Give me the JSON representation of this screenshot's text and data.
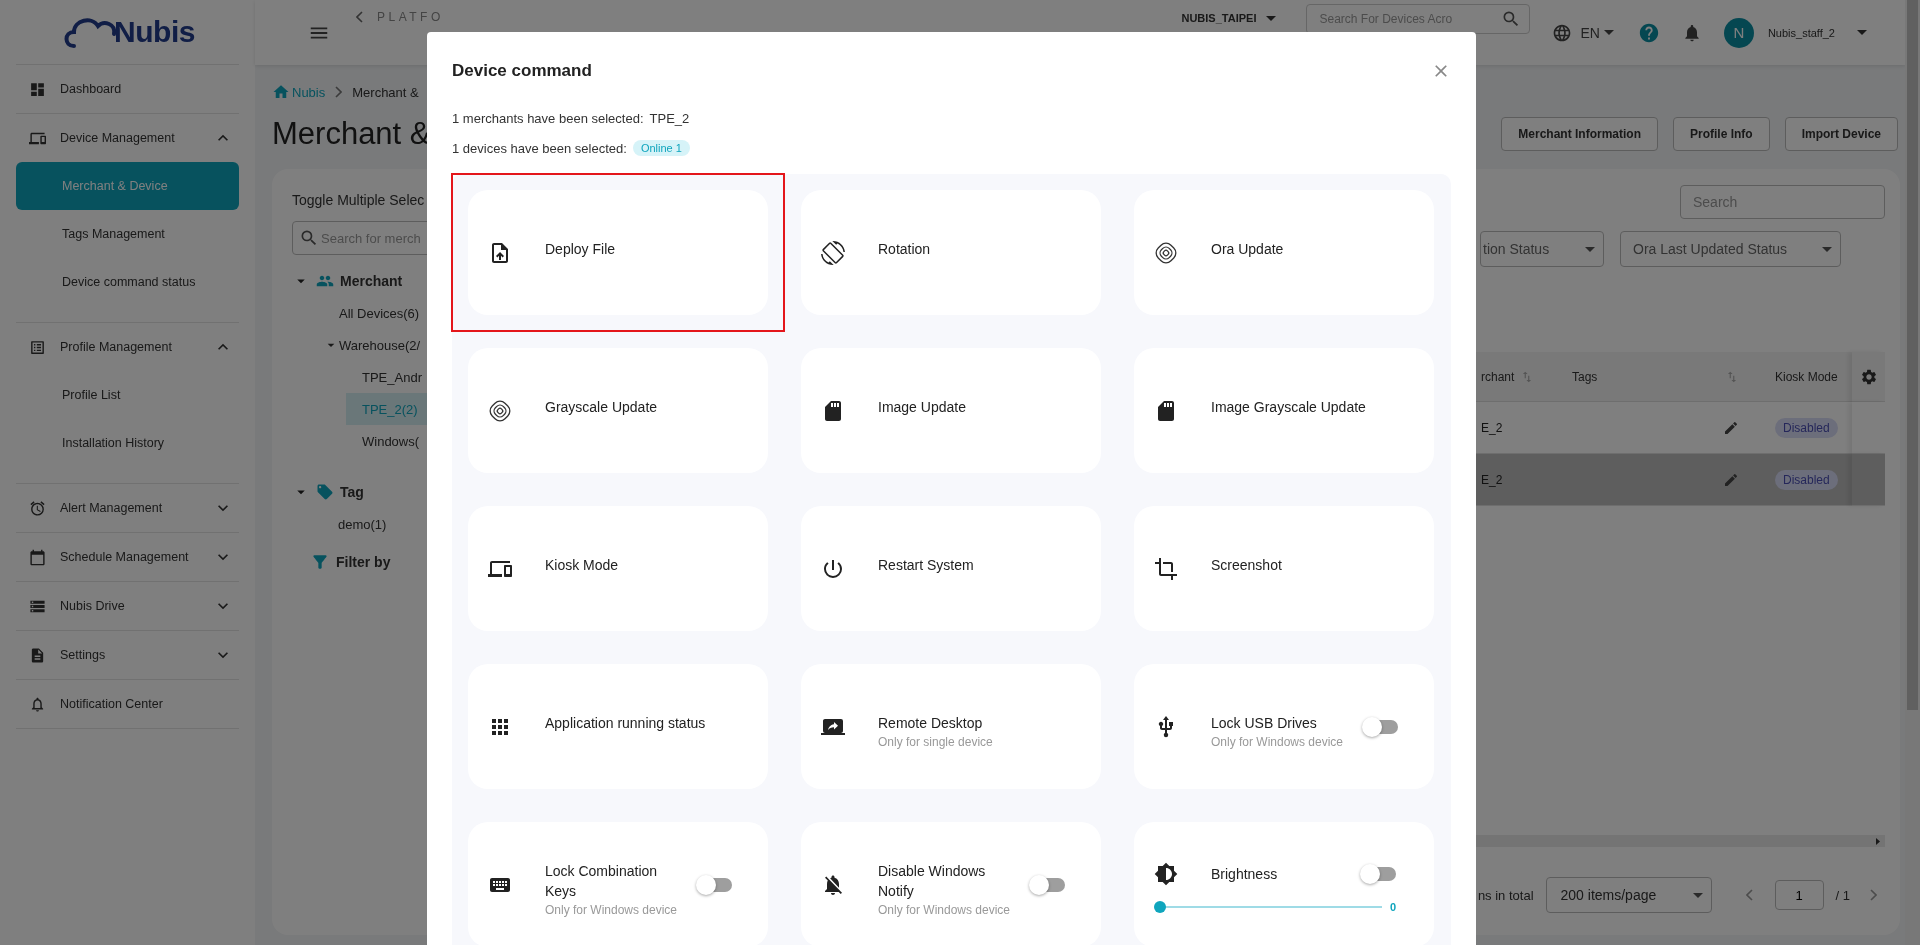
{
  "sidebar": {
    "logo": "Nubis",
    "items": [
      {
        "kind": "link",
        "label": "Dashboard",
        "selected": false
      },
      {
        "kind": "group",
        "label": "Device Management",
        "expanded": true,
        "children": [
          {
            "label": "Merchant & Device",
            "selected": true
          },
          {
            "label": "Tags Management",
            "selected": false
          },
          {
            "label": "Device command status",
            "selected": false
          }
        ]
      },
      {
        "kind": "group",
        "label": "Profile Management",
        "expanded": true,
        "children": [
          {
            "label": "Profile List",
            "selected": false
          },
          {
            "label": "Installation History",
            "selected": false
          }
        ]
      },
      {
        "kind": "group",
        "label": "Alert Management",
        "expanded": false
      },
      {
        "kind": "group",
        "label": "Schedule Management",
        "expanded": false
      },
      {
        "kind": "group",
        "label": "Nubis Drive",
        "expanded": false
      },
      {
        "kind": "group",
        "label": "Settings",
        "expanded": false
      },
      {
        "kind": "link",
        "label": "Notification Center",
        "selected": false
      }
    ]
  },
  "top_bar": {
    "back_label": "PLATFO",
    "tenant": "NUBIS_TAIPEI",
    "search": {
      "placeholder": "Search For Devices Acro"
    },
    "language": "EN",
    "user": {
      "initial": "N",
      "name": "Nubis_staff_2"
    }
  },
  "page": {
    "breadcrumb": [
      "Nubis",
      "Merchant &"
    ],
    "title": "Merchant &",
    "buttons": [
      "Merchant Information",
      "Profile Info",
      "Import Device"
    ],
    "tree_panel": {
      "toggle_label": "Toggle Multiple Selec",
      "search": {
        "placeholder": "Search for merch"
      },
      "sections": [
        {
          "kind": "merchant",
          "label": "Merchant",
          "expanded": true,
          "children": [
            {
              "label": "All Devices(6)",
              "selected": false
            },
            {
              "label": "Warehouse(2/",
              "selected": false,
              "expanded": true,
              "children": [
                {
                  "label": "TPE_Andr",
                  "selected": false
                },
                {
                  "label": "TPE_2(2)",
                  "selected": true
                },
                {
                  "label": "Windows(",
                  "selected": false
                }
              ]
            }
          ]
        },
        {
          "kind": "tag",
          "label": "Tag",
          "expanded": true,
          "children": [
            {
              "label": "demo(1)",
              "selected": false
            }
          ]
        }
      ],
      "filter_label": "Filter by"
    },
    "search": {
      "placeholder": "Search"
    },
    "filters": [
      "tion Status",
      "Ora Last Updated Status"
    ],
    "table": {
      "columns": [
        "rchant",
        "Tags",
        "Kiosk Mode"
      ],
      "rows": [
        {
          "merchant": "E_2",
          "kiosk_mode": "Disabled",
          "selected": false
        },
        {
          "merchant": "E_2",
          "kiosk_mode": "Disabled",
          "selected": true
        }
      ]
    },
    "pagination": {
      "total": "ns in total",
      "page_size": "200 items/page",
      "page": "1",
      "page_count": "/ 1"
    }
  },
  "modal": {
    "title": "Device command",
    "merchants": {
      "label": "1 merchants have been selected:",
      "value": "TPE_2"
    },
    "devices": {
      "label": "1 devices have been selected:",
      "badge": {
        "label": "Online",
        "count": "1"
      }
    },
    "commands": [
      {
        "kind": "plain",
        "label": "Deploy File",
        "highlighted": true
      },
      {
        "kind": "plain",
        "label": "Rotation",
        "highlighted": false
      },
      {
        "kind": "plain",
        "label": "Ora Update",
        "highlighted": false
      },
      {
        "kind": "plain",
        "label": "Grayscale Update",
        "highlighted": false
      },
      {
        "kind": "plain",
        "label": "Image Update",
        "highlighted": false
      },
      {
        "kind": "plain",
        "label": "Image Grayscale Update",
        "highlighted": false
      },
      {
        "kind": "plain",
        "label": "Kiosk Mode",
        "highlighted": false
      },
      {
        "kind": "plain",
        "label": "Restart System",
        "highlighted": false
      },
      {
        "kind": "plain",
        "label": "Screenshot",
        "highlighted": false
      },
      {
        "kind": "plain",
        "label": "Application running status",
        "highlighted": false
      },
      {
        "kind": "sub",
        "label": "Remote Desktop",
        "note": "Only for single device",
        "highlighted": false
      },
      {
        "kind": "toggle",
        "label": "Lock USB Drives",
        "note": "Only for Windows device",
        "on": false,
        "highlighted": false
      },
      {
        "kind": "toggle",
        "label": "Lock Combination Keys",
        "note": "Only for Windows device",
        "on": false,
        "highlighted": false
      },
      {
        "kind": "toggle",
        "label": "Disable Windows Notify",
        "note": "Only for Windows device",
        "on": false,
        "highlighted": false
      },
      {
        "kind": "slider",
        "label": "Brightness",
        "on": false,
        "level": 0,
        "reading": "0",
        "highlighted": false
      }
    ]
  }
}
